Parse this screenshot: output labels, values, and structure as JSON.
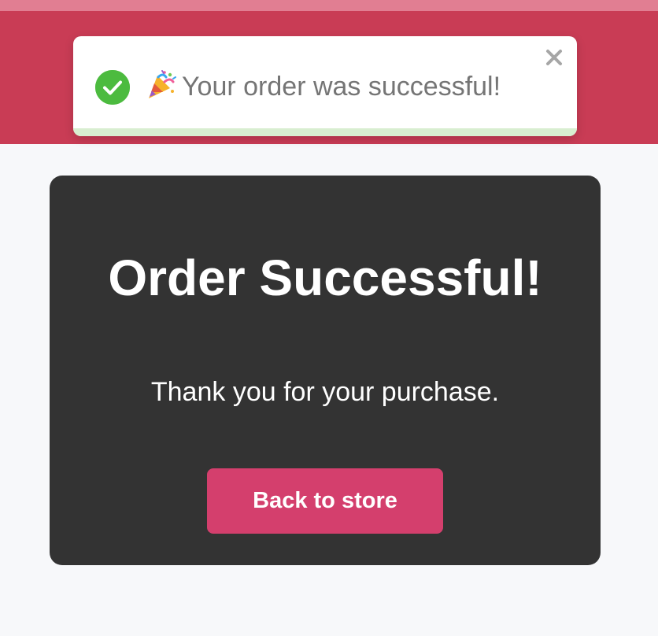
{
  "colors": {
    "header_background": "#c93c55",
    "header_topline": "#e17e92",
    "page_background": "#f7f8fa",
    "toast_background": "#ffffff",
    "success_icon": "#4cbb3f",
    "toast_text": "#757575",
    "close_icon": "#a6a6a6",
    "progress_bar": "#d8eed0",
    "card_background": "#333333",
    "button_background": "#d43f6d",
    "button_text": "#ffffff"
  },
  "toast": {
    "status_icon": "check-circle-icon",
    "emoji_icon": "party-popper-icon",
    "message": "Your order was successful!",
    "close_icon": "close-icon",
    "progress_fraction": 1
  },
  "card": {
    "title": "Order Successful!",
    "subtitle": "Thank you for your purchase.",
    "button_label": "Back to store"
  }
}
